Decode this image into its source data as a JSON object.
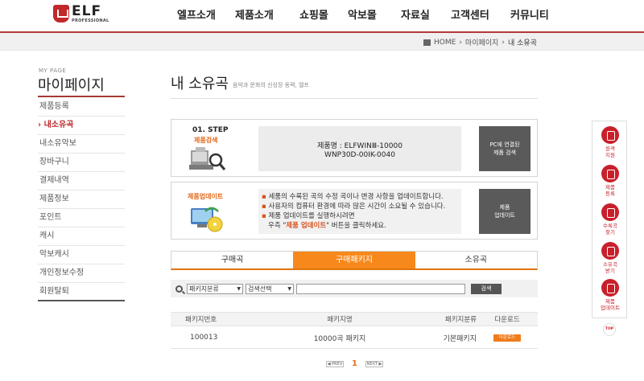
{
  "header": {
    "logo_text": "ELF",
    "logo_sub": "PROFESSIONAL",
    "nav": [
      "엘프소개",
      "제품소개",
      "쇼핑몰",
      "악보몰",
      "자료실",
      "고객센터",
      "커뮤니티"
    ]
  },
  "breadcrumb": [
    "HOME",
    "마이페이지",
    "내 소유곡"
  ],
  "sidebar": {
    "en_title": "MY PAGE",
    "title": "마이페이지",
    "items": [
      {
        "label": "제품등록"
      },
      {
        "label": "내소유곡"
      },
      {
        "label": "내소유악보"
      },
      {
        "label": "장바구니"
      },
      {
        "label": "결제내역"
      },
      {
        "label": "제품정보"
      },
      {
        "label": "포인트"
      },
      {
        "label": "캐시"
      },
      {
        "label": "악보캐시"
      },
      {
        "label": "개인정보수정"
      },
      {
        "label": "회원탈퇴"
      }
    ],
    "active_index": 1
  },
  "content": {
    "title": "내 소유곡",
    "subtitle": "음악과 문화의 신성장 동력, 엘프"
  },
  "step1": {
    "title": "01. STEP",
    "sub": "제품검색",
    "product_line1": "제품명 : ELFWINⅢ-10000",
    "product_line2": "WNP30D-00IK-0040",
    "button_line1": "PC에 연결된",
    "button_line2": "제품 검색"
  },
  "step2": {
    "sub": "제품업데이트",
    "note1_bullet": "▪",
    "note1": "세품의 수록된 곡의 수정 곡이나 변경 사항을 업데이트합니다.",
    "note2_bullet": "▪",
    "note2": "사용자의 컴퓨터 환경에 따라 많은 시간이 소요될 수 있습니다.",
    "note3_bullet": "▪",
    "note3": "제품 업데이트를 실행하시려면",
    "note4_pre": "우측 \"",
    "note4_hl": "제품 업데이트",
    "note4_post": "\" 버튼을 클릭하세요.",
    "button_line1": "제품",
    "button_line2": "업데이트"
  },
  "tabs": {
    "items": [
      "구매곡",
      "구매패키지",
      "소유곡"
    ],
    "active_index": 1
  },
  "search": {
    "category_select": "패키지분류",
    "field_select": "검색선택",
    "input_value": "",
    "button": "검색"
  },
  "table": {
    "headers": [
      "패키지번호",
      "패키지명",
      "패키지분류",
      "다운로드"
    ],
    "rows": [
      {
        "no": "100013",
        "name": "10000곡 패키지",
        "type": "기본패키지",
        "download": "다운로드"
      }
    ]
  },
  "pagination": {
    "prev": "◀ PREV",
    "current": "1",
    "next": "NEXT ▶"
  },
  "quickbar": {
    "items": [
      {
        "icon": "mouse-icon",
        "line1": "원격",
        "line2": "지원"
      },
      {
        "icon": "register-icon",
        "line1": "제품",
        "line2": "등록"
      },
      {
        "icon": "music-note-icon",
        "line1": "수록곡",
        "line2": "찾기"
      },
      {
        "icon": "download-icon",
        "line1": "소유곡",
        "line2": "받기"
      },
      {
        "icon": "refresh-icon",
        "line1": "제품",
        "line2": "업데이트"
      }
    ],
    "top_label": "TOP"
  },
  "colors": {
    "brand_red": "#c0282c",
    "accent_orange": "#f7891c",
    "dark_button": "#5a5a5a"
  }
}
